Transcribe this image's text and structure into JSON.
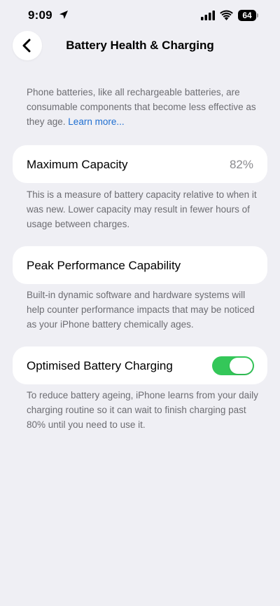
{
  "status_bar": {
    "time": "9:09",
    "battery_level": "64",
    "icons": [
      "location-arrow-icon",
      "signal-icon",
      "wifi-icon",
      "battery-icon"
    ]
  },
  "nav": {
    "title": "Battery Health & Charging",
    "back_icon": "chevron-left-icon"
  },
  "intro": {
    "text": "Phone batteries, like all rechargeable batteries, are consumable components that become less effective as they age. ",
    "link": "Learn more..."
  },
  "max_capacity": {
    "label": "Maximum Capacity",
    "value": "82%",
    "footnote": "This is a measure of battery capacity relative to when it was new. Lower capacity may result in fewer hours of usage between charges."
  },
  "peak_performance": {
    "label": "Peak Performance Capability",
    "footnote": "Built-in dynamic software and hardware systems will help counter performance impacts that may be noticed as your iPhone battery chemically ages."
  },
  "optimised_charging": {
    "label": "Optimised Battery Charging",
    "enabled": true,
    "footnote": "To reduce battery ageing, iPhone learns from your daily charging routine so it can wait to finish charging past 80% until you need to use it."
  },
  "colors": {
    "background": "#efeff4",
    "accent_link": "#1f6fd1",
    "toggle_on": "#34c759",
    "secondary_text": "#6d6d72"
  }
}
